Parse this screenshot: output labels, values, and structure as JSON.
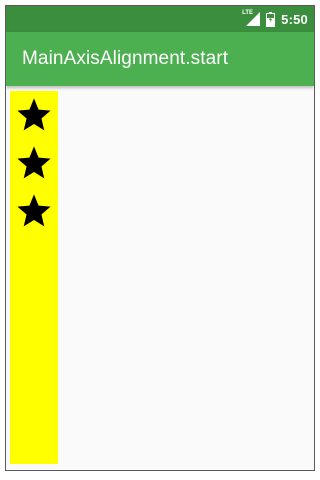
{
  "status_bar": {
    "network_label": "LTE",
    "time": "5:50",
    "background_color": "#3b8e3e"
  },
  "app_bar": {
    "title": "MainAxisAlignment.start",
    "background_color": "#4caf50"
  },
  "column": {
    "background_color": "#ffff00",
    "main_axis_alignment": "start",
    "children": [
      {
        "icon": "star-icon"
      },
      {
        "icon": "star-icon"
      },
      {
        "icon": "star-icon"
      }
    ]
  }
}
